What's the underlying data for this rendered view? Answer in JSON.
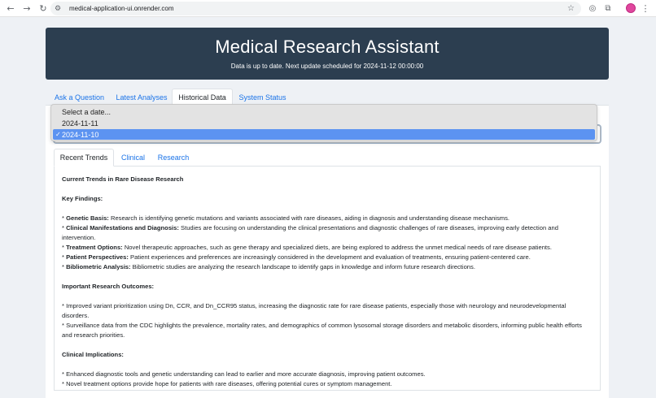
{
  "browser": {
    "url": "medical-application-ui.onrender.com",
    "back_icon": "arrow-left-icon",
    "forward_icon": "arrow-right-icon",
    "reload_icon": "reload-icon"
  },
  "header": {
    "title": "Medical Research Assistant",
    "subtitle": "Data is up to date. Next update scheduled for 2024-11-12 00:00:00"
  },
  "tabs": [
    {
      "label": "Ask a Question"
    },
    {
      "label": "Latest Analyses"
    },
    {
      "label": "Historical Data"
    },
    {
      "label": "System Status"
    }
  ],
  "active_tab": "Historical Data",
  "date_dropdown": {
    "options": [
      "Select a date...",
      "2024-11-11",
      "2024-11-10"
    ],
    "selected": "2024-11-10"
  },
  "subtabs": [
    {
      "label": "Recent Trends"
    },
    {
      "label": "Clinical"
    },
    {
      "label": "Research"
    }
  ],
  "active_subtab": "Recent Trends",
  "report": {
    "title": "Current Trends in Rare Disease Research",
    "key_findings_heading": "Key Findings:",
    "key_findings": [
      {
        "term": "Genetic Basis:",
        "text": " Research is identifying genetic mutations and variants associated with rare diseases, aiding in diagnosis and understanding disease mechanisms."
      },
      {
        "term": "Clinical Manifestations and Diagnosis:",
        "text": " Studies are focusing on understanding the clinical presentations and diagnostic challenges of rare diseases, improving early detection and intervention."
      },
      {
        "term": "Treatment Options:",
        "text": " Novel therapeutic approaches, such as gene therapy and specialized diets, are being explored to address the unmet medical needs of rare disease patients."
      },
      {
        "term": "Patient Perspectives:",
        "text": " Patient experiences and preferences are increasingly considered in the development and evaluation of treatments, ensuring patient-centered care."
      },
      {
        "term": "Bibliometric Analysis:",
        "text": " Bibliometric studies are analyzing the research landscape to identify gaps in knowledge and inform future research directions."
      }
    ],
    "outcomes_heading": "Important Research Outcomes:",
    "outcomes": [
      "Improved variant prioritization using Dn, CCR, and Dn_CCR95 status, increasing the diagnostic rate for rare disease patients, especially those with neurology and neurodevelopmental disorders.",
      "Surveillance data from the CDC highlights the prevalence, mortality rates, and demographics of common lysosomal storage disorders and metabolic disorders, informing public health efforts and research priorities."
    ],
    "implications_heading": "Clinical Implications:",
    "implications": [
      "Enhanced diagnostic tools and genetic understanding can lead to earlier and more accurate diagnosis, improving patient outcomes.",
      "Novel treatment options provide hope for patients with rare diseases, offering potential cures or symptom management."
    ]
  }
}
